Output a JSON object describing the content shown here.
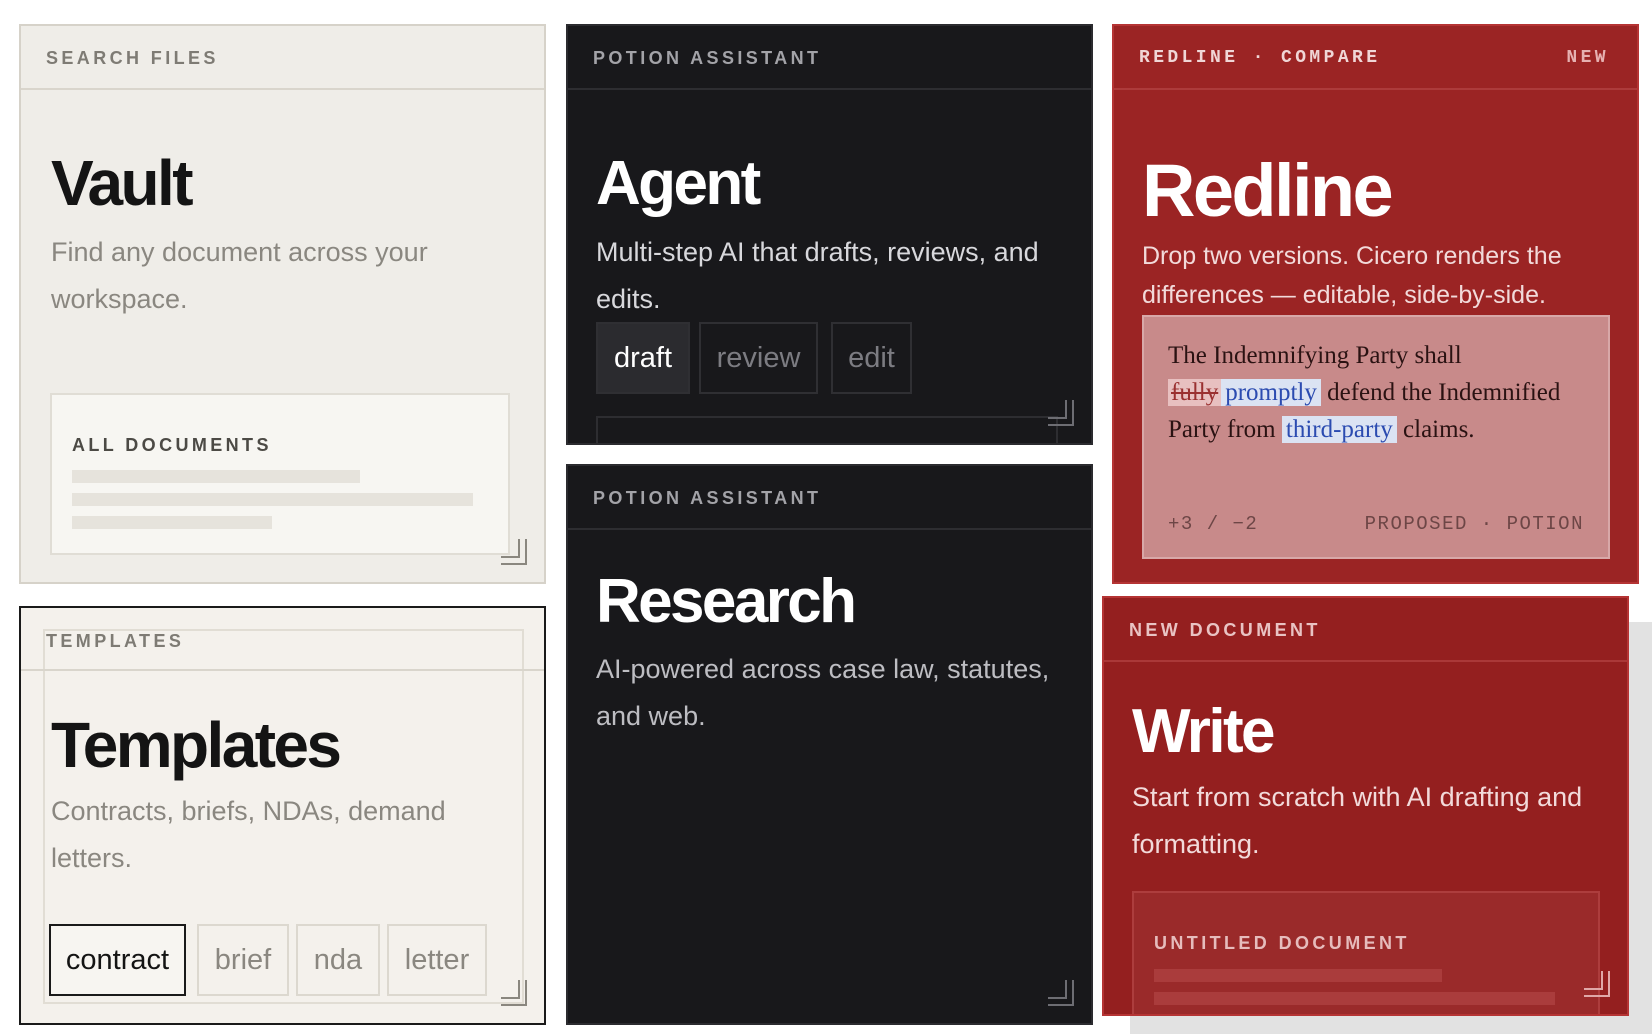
{
  "vault": {
    "header": "SEARCH FILES",
    "title": "Vault",
    "description": "Find any document across your workspace.",
    "panel_label": "ALL DOCUMENTS"
  },
  "templates": {
    "header": "TEMPLATES",
    "title": "Templates",
    "description": "Contracts, briefs, NDAs, demand letters.",
    "chips": [
      "contract",
      "brief",
      "nda",
      "letter"
    ],
    "selected": "contract"
  },
  "agent": {
    "header": "POTION ASSISTANT",
    "title": "Agent",
    "description": "Multi-step AI that drafts, reviews, and edits.",
    "chips": [
      "draft",
      "review",
      "edit"
    ],
    "selected": "draft"
  },
  "research": {
    "header": "POTION ASSISTANT",
    "title": "Research",
    "description": "AI-powered across case law, statutes, and web."
  },
  "redline": {
    "header": "REDLINE · COMPARE",
    "badge": "NEW",
    "title": "Redline",
    "description": "Drop two versions. Cicero renders the differences — editable, side-by-side.",
    "doc": {
      "text_1": "The Indemnifying Party shall",
      "deleted": "fully",
      "inserted_1": "promptly",
      "text_2": "defend the Indemnified Party from",
      "inserted_2": "third-party",
      "text_3": "claims.",
      "stats": "+3 / −2",
      "status": "PROPOSED · POTION"
    }
  },
  "write": {
    "header": "NEW DOCUMENT",
    "title": "Write",
    "description": "Start from scratch with AI drafting and formatting.",
    "panel_label": "UNTITLED DOCUMENT"
  }
}
